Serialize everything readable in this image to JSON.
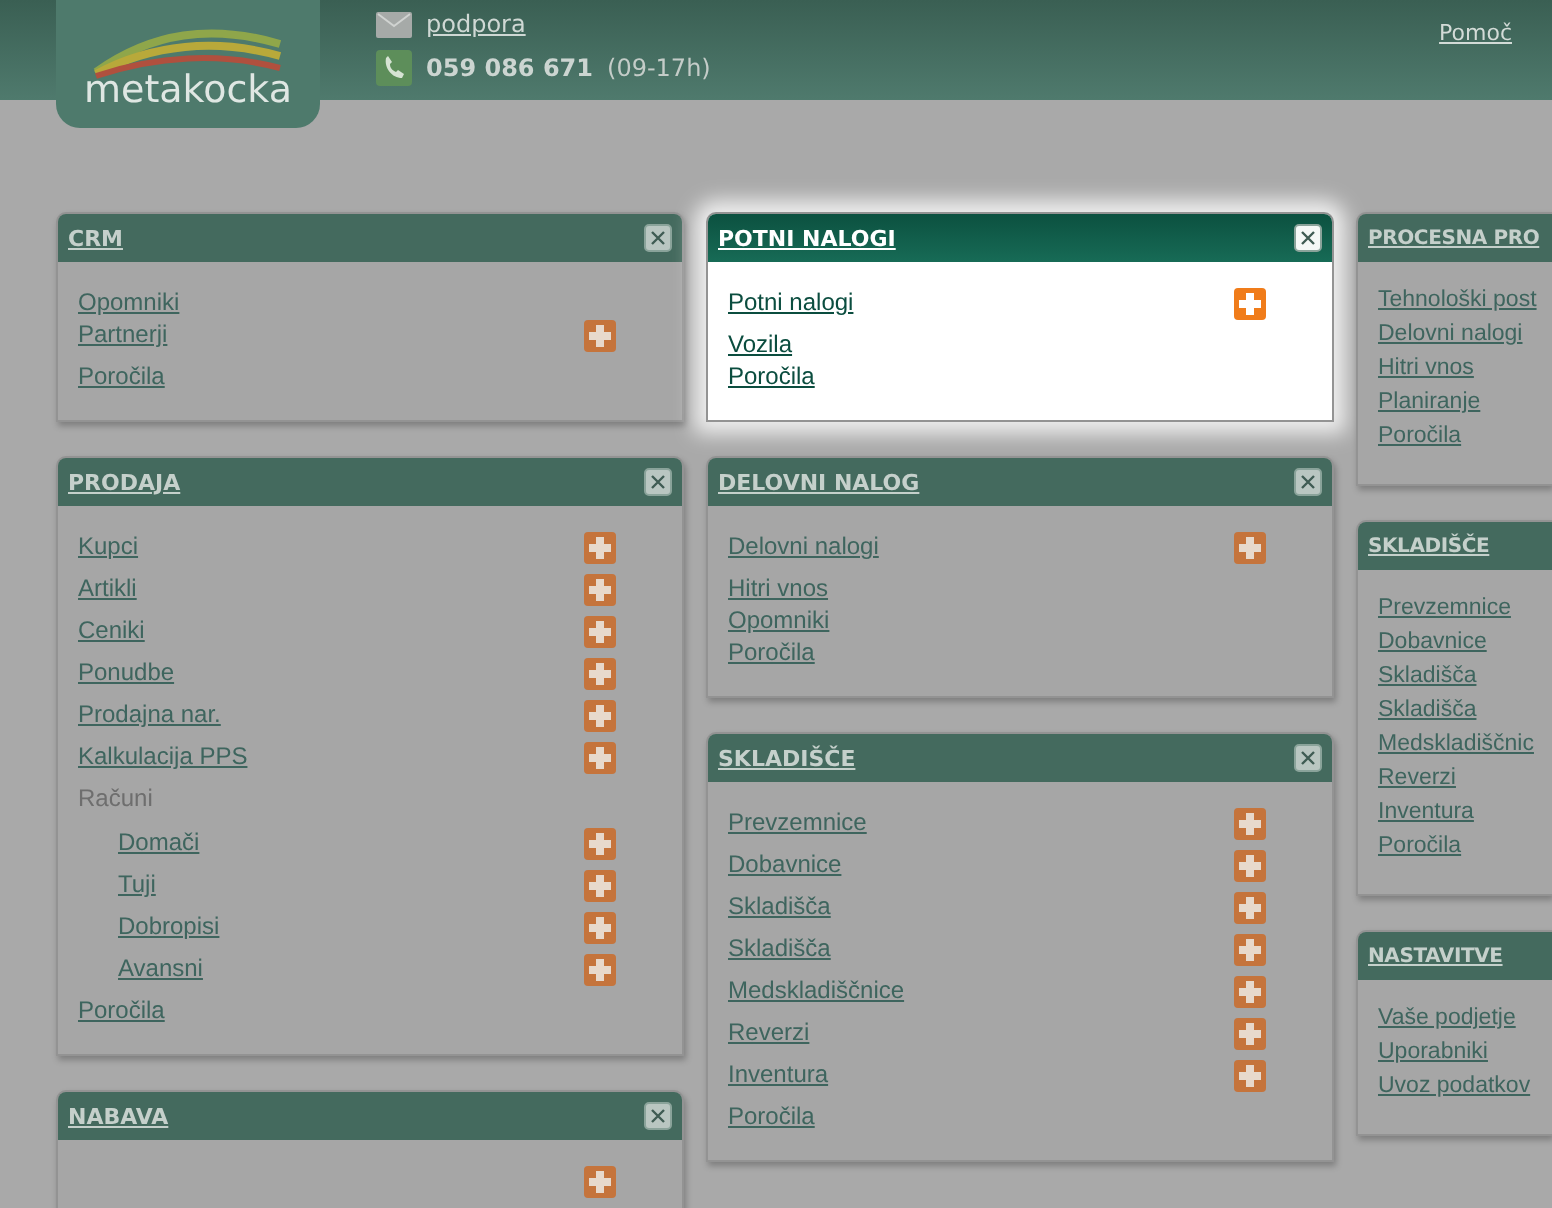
{
  "header": {
    "logo_text": "metakocka",
    "support_link": "podpora",
    "phone": "059 086 671",
    "hours": "(09-17h)",
    "help_link": "Pomoč"
  },
  "columns": [
    {
      "panels": [
        {
          "title": "CRM",
          "selected": false,
          "close_button": true,
          "items": [
            {
              "label": "Opomniki",
              "plus": false
            },
            {
              "label": "Partnerji",
              "plus": true
            },
            {
              "label": "Poročila",
              "plus": false
            }
          ]
        },
        {
          "title": "PRODAJA",
          "selected": false,
          "close_button": true,
          "items": [
            {
              "label": "Kupci",
              "plus": true
            },
            {
              "label": "Artikli",
              "plus": true
            },
            {
              "label": "Ceniki",
              "plus": true
            },
            {
              "label": "Ponudbe",
              "plus": true
            },
            {
              "label": "Prodajna nar.",
              "plus": true
            },
            {
              "label": "Kalkulacija PPS",
              "plus": true
            },
            {
              "label": "Računi",
              "plus": false,
              "children": [
                {
                  "label": "Domači",
                  "plus": true
                },
                {
                  "label": "Tuji",
                  "plus": true
                },
                {
                  "label": "Dobropisi",
                  "plus": true
                },
                {
                  "label": "Avansni",
                  "plus": true
                }
              ]
            },
            {
              "label": "Poročila",
              "plus": false
            }
          ]
        },
        {
          "title": "NABAVA",
          "selected": false,
          "close_button": true,
          "items": [
            {
              "plus": true
            }
          ]
        }
      ]
    },
    {
      "panels": [
        {
          "title": "POTNI NALOGI",
          "selected": true,
          "close_button": true,
          "items": [
            {
              "label": "Potni nalogi",
              "plus": true
            },
            {
              "label": "Vozila",
              "plus": false
            },
            {
              "label": "Poročila",
              "plus": false
            }
          ]
        },
        {
          "title": "DELOVNI NALOG",
          "selected": false,
          "close_button": true,
          "items": [
            {
              "label": "Delovni nalogi",
              "plus": true
            },
            {
              "label": "Hitri vnos",
              "plus": false
            },
            {
              "label": "Opomniki",
              "plus": false
            },
            {
              "label": "Poročila",
              "plus": false
            }
          ]
        },
        {
          "title": "SKLADIŠČE",
          "selected": false,
          "close_button": true,
          "items": [
            {
              "label": "Prevzemnice",
              "plus": true
            },
            {
              "label": "Dobavnice",
              "plus": true
            },
            {
              "label": "Skladišča",
              "plus": true
            },
            {
              "label": "Skladišča",
              "plus": true
            },
            {
              "label": "Medskladiščnice",
              "plus": true
            },
            {
              "label": "Reverzi",
              "plus": true
            },
            {
              "label": "Inventura",
              "plus": true
            },
            {
              "label": "Poročila",
              "plus": false
            }
          ]
        }
      ]
    },
    {
      "panels": [
        {
          "title": "PROCESNA PRO",
          "selected": false,
          "close_button": false,
          "items": [
            {
              "label": "Tehnološki post",
              "plus": false
            },
            {
              "label": "Delovni nalogi",
              "plus": false
            },
            {
              "label": "Hitri vnos",
              "plus": false
            },
            {
              "label": "Planiranje",
              "plus": false
            },
            {
              "label": "Poročila",
              "plus": false
            }
          ]
        },
        {
          "title": "SKLADIŠČE",
          "selected": false,
          "close_button": false,
          "items": [
            {
              "label": "Prevzemnice",
              "plus": false
            },
            {
              "label": "Dobavnice",
              "plus": false
            },
            {
              "label": "Skladišča",
              "plus": false
            },
            {
              "label": "Skladišča",
              "plus": false
            },
            {
              "label": "Medskladiščnic",
              "plus": false
            },
            {
              "label": "Reverzi",
              "plus": false
            },
            {
              "label": "Inventura",
              "plus": false
            },
            {
              "label": "Poročila",
              "plus": false
            }
          ]
        },
        {
          "title": "NASTAVITVE",
          "selected": false,
          "close_button": false,
          "items": [
            {
              "label": "Vaše podjetje",
              "plus": false
            },
            {
              "label": "Uporabniki",
              "plus": false
            },
            {
              "label": "Uvoz podatkov",
              "plus": false
            }
          ]
        }
      ]
    }
  ]
}
